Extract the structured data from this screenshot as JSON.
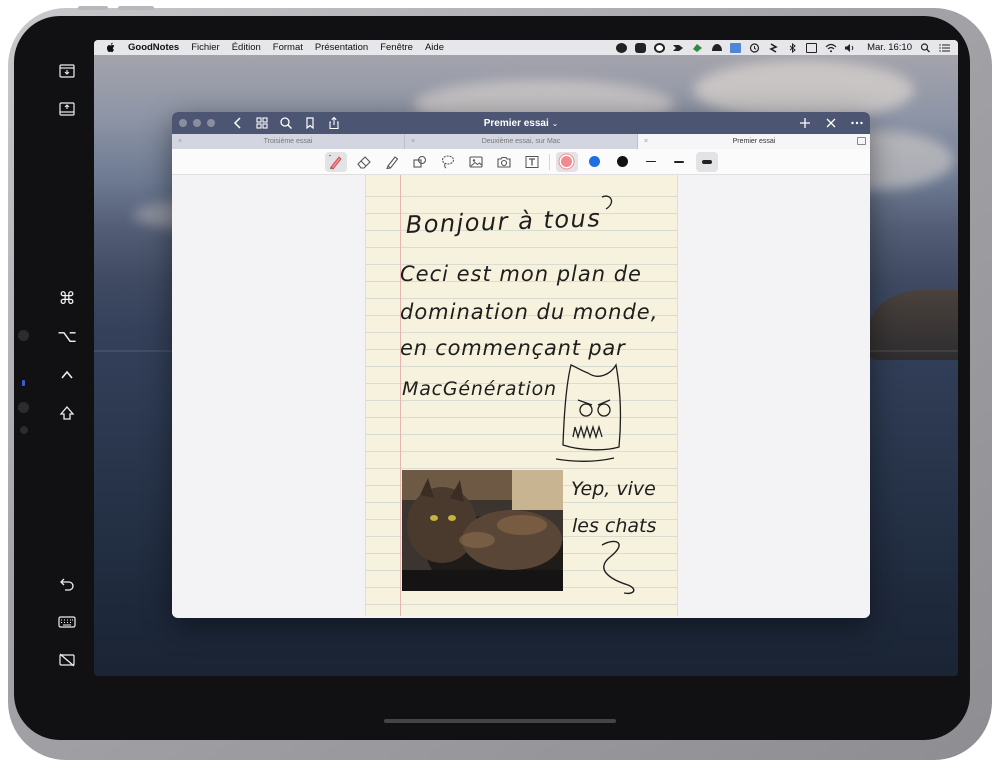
{
  "menubar": {
    "app_name": "GoodNotes",
    "items": [
      "Fichier",
      "Édition",
      "Format",
      "Présentation",
      "Fenêtre",
      "Aide"
    ],
    "clock": "Mar. 16:10"
  },
  "window": {
    "title": "Premier essai",
    "title_chevron": "⌄",
    "tabs": [
      {
        "label": "Troisième essai",
        "active": false
      },
      {
        "label": "Deuxième essai, sur Mac",
        "active": false
      },
      {
        "label": "Premier essai",
        "active": true
      }
    ],
    "tab_close": "×",
    "toolbar_colors": [
      "#f08a8f",
      "#1f6fe0",
      "#111111"
    ]
  },
  "note": {
    "handwritten_lines": [
      "Bonjour à tous",
      "Ceci est mon plan de",
      "domination du monde,",
      "en commençant par",
      "MacGénération",
      "Yep, vive",
      "les chats"
    ]
  },
  "sidebar_keys": {
    "command": "⌘",
    "option": "⌥",
    "control": "^",
    "shift": "⇧"
  }
}
